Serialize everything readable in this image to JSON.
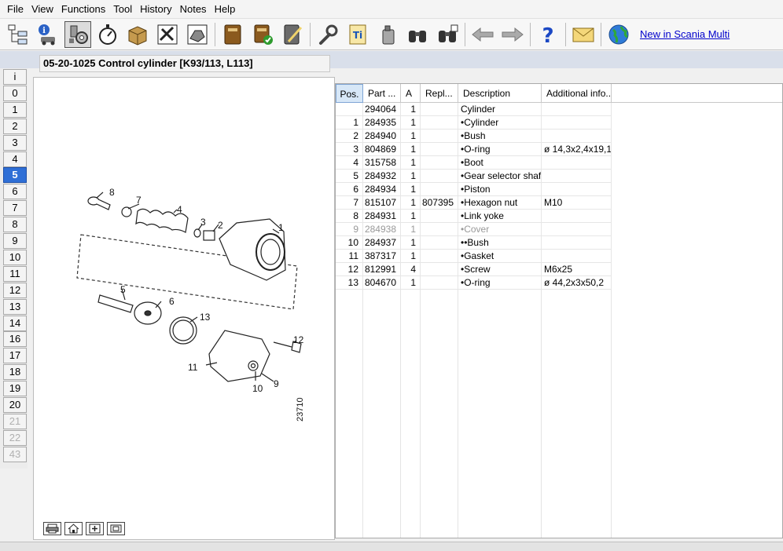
{
  "menu": [
    "File",
    "View",
    "Functions",
    "Tool",
    "History",
    "Notes",
    "Help"
  ],
  "toolbar": {
    "buttons": [
      {
        "name": "structure-tree-icon",
        "active": false
      },
      {
        "name": "vehicle-info-icon",
        "active": false
      },
      {
        "name": "engine-parts-icon",
        "active": true
      },
      {
        "name": "stopwatch-icon",
        "active": false
      },
      {
        "name": "package-icon",
        "active": false
      },
      {
        "name": "workshop-tools-icon",
        "active": false
      },
      {
        "name": "engine-drawing-icon",
        "active": false
      },
      {
        "name": "manual-book-icon",
        "active": false
      },
      {
        "name": "book-check-icon",
        "active": false
      },
      {
        "name": "notes-pencil-icon",
        "active": false
      },
      {
        "name": "wrench-icon",
        "active": false
      },
      {
        "name": "technical-information-icon",
        "active": false
      },
      {
        "name": "oil-bottle-icon",
        "active": false
      },
      {
        "name": "binoculars-icon",
        "active": false
      },
      {
        "name": "binoculars-search-icon",
        "active": false
      },
      {
        "name": "back-arrow-icon",
        "active": false
      },
      {
        "name": "forward-arrow-icon",
        "active": false
      },
      {
        "name": "help-question-icon",
        "active": false
      },
      {
        "name": "mail-envelope-icon",
        "active": false
      },
      {
        "name": "globe-icon",
        "active": false
      }
    ],
    "new_link": "New in Scania Multi"
  },
  "index": {
    "items": [
      "i",
      "0",
      "1",
      "2",
      "3",
      "4",
      "5",
      "6",
      "7",
      "8",
      "9",
      "10",
      "11",
      "12",
      "13",
      "14",
      "16",
      "17",
      "18",
      "19",
      "20",
      "21",
      "22",
      "43"
    ],
    "selected": "5",
    "disabled": [
      "21",
      "22",
      "43"
    ]
  },
  "page_title": "05-20-1025 Control cylinder [K93/113, L113]",
  "drawing": {
    "callouts": [
      "8",
      "7",
      "4",
      "3",
      "2",
      "1",
      "5",
      "6",
      "13",
      "12",
      "11",
      "10",
      "9"
    ],
    "figure_number": "23710"
  },
  "bottom_buttons": [
    {
      "name": "print-icon"
    },
    {
      "name": "home-icon"
    },
    {
      "name": "zoom-in-icon"
    },
    {
      "name": "fit-view-icon"
    }
  ],
  "table": {
    "headers": [
      "Pos.",
      "Part ...",
      "A",
      "Repl...",
      "Description",
      "Additional info..."
    ],
    "rows": [
      {
        "pos": "",
        "part": "294064",
        "a": "1",
        "repl": "",
        "desc": "Cylinder",
        "info": "",
        "dim": false
      },
      {
        "pos": "1",
        "part": "284935",
        "a": "1",
        "repl": "",
        "desc": "•Cylinder",
        "info": "",
        "dim": false
      },
      {
        "pos": "2",
        "part": "284940",
        "a": "1",
        "repl": "",
        "desc": "•Bush",
        "info": "",
        "dim": false
      },
      {
        "pos": "3",
        "part": "804869",
        "a": "1",
        "repl": "",
        "desc": "•O-ring",
        "info": "ø 14,3x2,4x19,1",
        "dim": false
      },
      {
        "pos": "4",
        "part": "315758",
        "a": "1",
        "repl": "",
        "desc": "•Boot",
        "info": "",
        "dim": false
      },
      {
        "pos": "5",
        "part": "284932",
        "a": "1",
        "repl": "",
        "desc": "•Gear selector shaft",
        "info": "",
        "dim": false
      },
      {
        "pos": "6",
        "part": "284934",
        "a": "1",
        "repl": "",
        "desc": "•Piston",
        "info": "",
        "dim": false
      },
      {
        "pos": "7",
        "part": "815107",
        "a": "1",
        "repl": "807395",
        "desc": "•Hexagon nut",
        "info": "M10",
        "dim": false
      },
      {
        "pos": "8",
        "part": "284931",
        "a": "1",
        "repl": "",
        "desc": "•Link yoke",
        "info": "",
        "dim": false
      },
      {
        "pos": "9",
        "part": "284938",
        "a": "1",
        "repl": "",
        "desc": "•Cover",
        "info": "",
        "dim": true
      },
      {
        "pos": "10",
        "part": "284937",
        "a": "1",
        "repl": "",
        "desc": "••Bush",
        "info": "",
        "dim": false
      },
      {
        "pos": "11",
        "part": "387317",
        "a": "1",
        "repl": "",
        "desc": "•Gasket",
        "info": "",
        "dim": false
      },
      {
        "pos": "12",
        "part": "812991",
        "a": "4",
        "repl": "",
        "desc": "•Screw",
        "info": "M6x25",
        "dim": false
      },
      {
        "pos": "13",
        "part": "804670",
        "a": "1",
        "repl": "",
        "desc": "•O-ring",
        "info": "ø 44,2x3x50,2",
        "dim": false
      }
    ]
  }
}
